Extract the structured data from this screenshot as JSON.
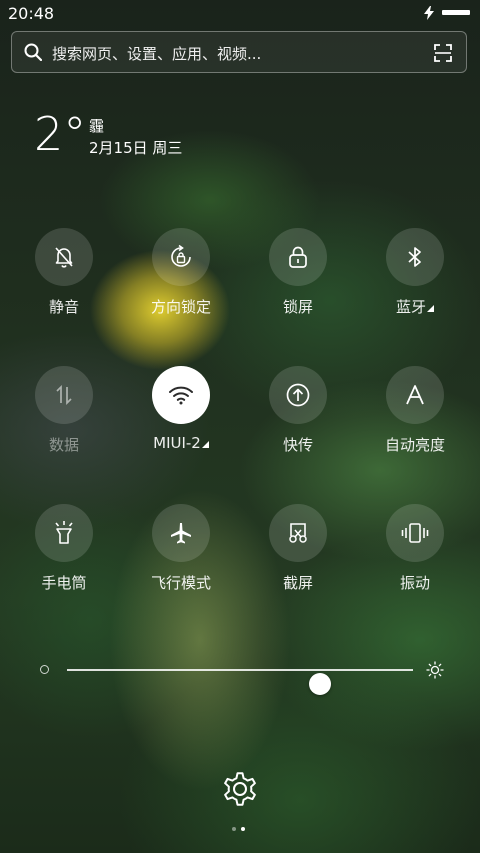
{
  "status_bar": {
    "time": "20:48",
    "charging_icon": "lightning-icon",
    "battery_icon": "battery-icon"
  },
  "search": {
    "placeholder": "搜索网页、设置、应用、视频...",
    "icon": "search-icon",
    "scan_icon": "scan-icon"
  },
  "weather": {
    "temperature": "2°",
    "condition": "霾",
    "date": "2月15日 周三"
  },
  "toggles": [
    {
      "label": "静音",
      "icon": "bell-mute-icon",
      "active": false
    },
    {
      "label": "方向锁定",
      "icon": "rotation-lock-icon",
      "active": false
    },
    {
      "label": "锁屏",
      "icon": "lock-icon",
      "active": false
    },
    {
      "label": "蓝牙",
      "icon": "bluetooth-icon",
      "active": false
    },
    {
      "label": "数据",
      "icon": "mobile-data-icon",
      "active": false
    },
    {
      "label": "MIUI-2",
      "icon": "wifi-icon",
      "active": true
    },
    {
      "label": "快传",
      "icon": "transfer-icon",
      "active": false
    },
    {
      "label": "自动亮度",
      "icon": "auto-brightness-icon",
      "active": false
    },
    {
      "label": "手电筒",
      "icon": "flashlight-icon",
      "active": false
    },
    {
      "label": "飞行模式",
      "icon": "airplane-icon",
      "active": false
    },
    {
      "label": "截屏",
      "icon": "screenshot-icon",
      "active": false
    },
    {
      "label": "振动",
      "icon": "vibrate-icon",
      "active": false
    }
  ],
  "brightness": {
    "level": 0.73
  },
  "pager": {
    "count": 2,
    "active": 1
  },
  "colors": {
    "active_tile": "#ffffff",
    "active_icon": "#2b2b2b",
    "inactive_tile": "rgba(255,255,255,0.14)"
  }
}
